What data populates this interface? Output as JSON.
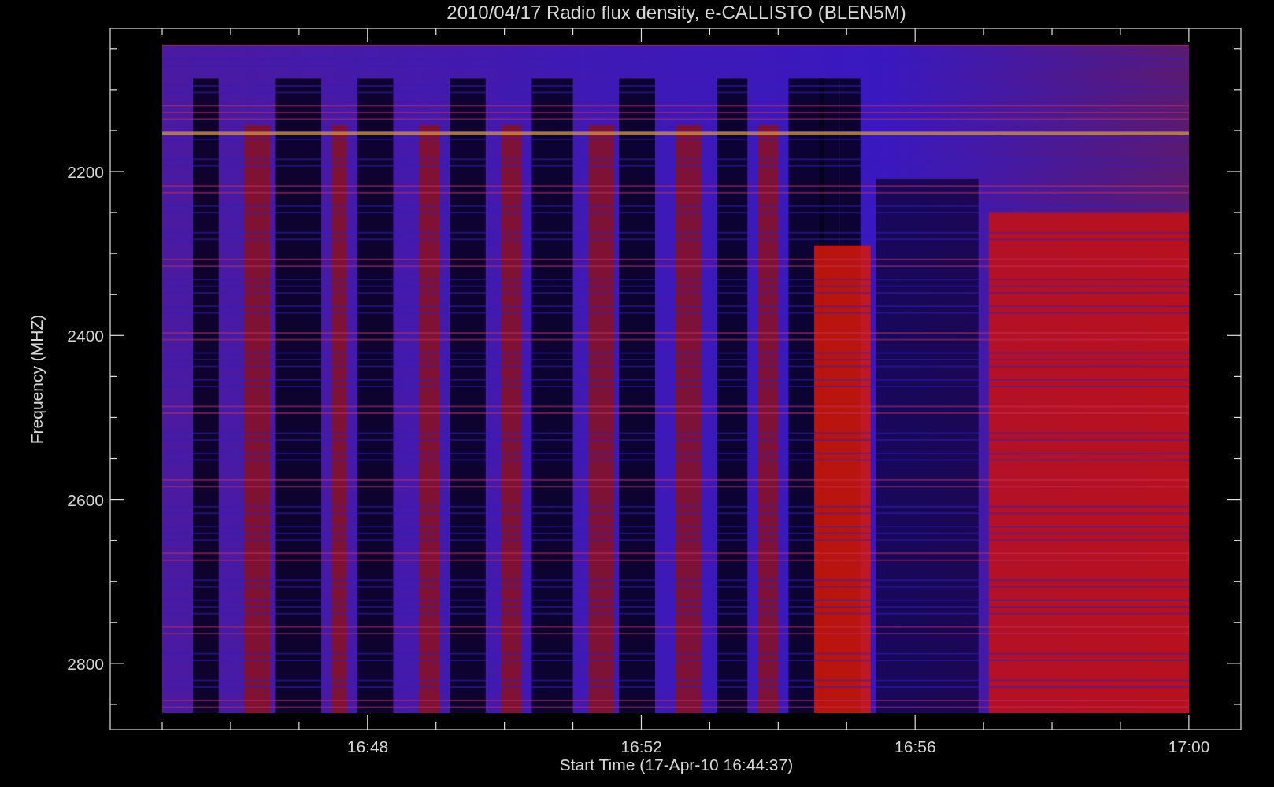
{
  "title": "2010/04/17  Radio flux density, e-CALLISTO (BLEN5M)",
  "y_axis": {
    "label": "Frequency (MHZ)",
    "ticks": [
      "2200",
      "2400",
      "2600",
      "2800"
    ]
  },
  "x_axis": {
    "label": "Start Time (17-Apr-10 16:44:37)",
    "ticks": [
      "16:48",
      "16:52",
      "16:56",
      "17:00"
    ]
  }
}
